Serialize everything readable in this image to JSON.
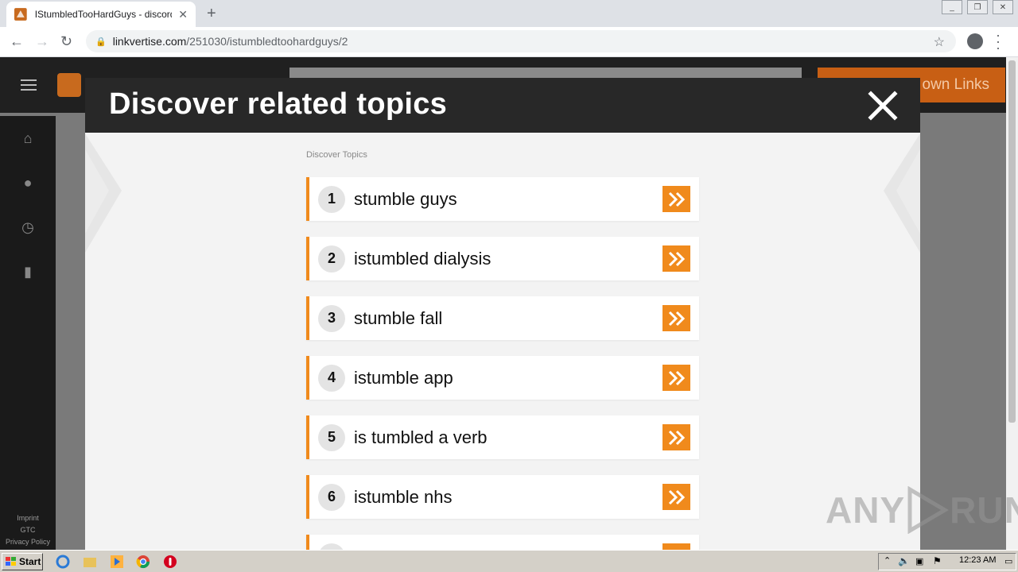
{
  "browser": {
    "tab_title": "IStumbledTooHardGuys - discord.gg",
    "url_host": "linkvertise.com",
    "url_path": "/251030/istumbledtoohardguys/2"
  },
  "page": {
    "download_label": "own Links",
    "footer_links": [
      "Imprint",
      "GTC",
      "Privacy Policy"
    ]
  },
  "modal": {
    "title": "Discover related topics",
    "section_label": "Discover Topics",
    "topics": [
      {
        "num": "1",
        "label": "stumble guys"
      },
      {
        "num": "2",
        "label": "istumbled dialysis"
      },
      {
        "num": "3",
        "label": "stumble fall"
      },
      {
        "num": "4",
        "label": "istumble app"
      },
      {
        "num": "5",
        "label": "is tumbled a verb"
      },
      {
        "num": "6",
        "label": "istumble nhs"
      }
    ]
  },
  "taskbar": {
    "start_label": "Start",
    "clock": "12:23 AM"
  },
  "watermark": {
    "text_a": "ANY",
    "text_b": "RUN"
  },
  "colors": {
    "accent": "#f08a1c",
    "modal_header": "#282828",
    "modal_bg": "#f3f3f3"
  }
}
